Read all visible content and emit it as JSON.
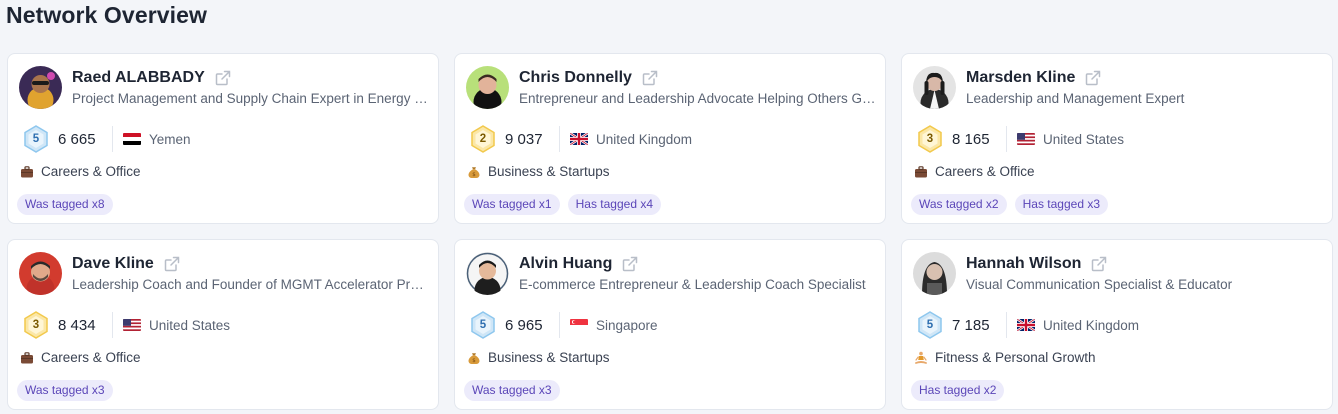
{
  "page": {
    "title": "Network Overview"
  },
  "colors": {
    "tag_bg": "#ecebfb",
    "tag_text": "#5b46b8",
    "gold_badge": "#f2c94c",
    "blue_badge": "#8ec7ee"
  },
  "profiles": [
    {
      "name": "Raed ALABBADY",
      "headline": "Project Management and Supply Chain Expert in Energy Sector",
      "level": "5",
      "level_style": "blue",
      "followers": "6 665",
      "flag": "yemen",
      "country": "Yemen",
      "category_icon": "briefcase-icon",
      "category": "Careers & Office",
      "tags": [
        "Was tagged x8"
      ]
    },
    {
      "name": "Chris Donnelly",
      "headline": "Entrepreneur and Leadership Advocate Helping Others Grow",
      "level": "2",
      "level_style": "gold",
      "followers": "9 037",
      "flag": "uk",
      "country": "United Kingdom",
      "category_icon": "money-bag-icon",
      "category": "Business & Startups",
      "tags": [
        "Was tagged x1",
        "Has tagged x4"
      ]
    },
    {
      "name": "Marsden Kline",
      "headline": "Leadership and Management Expert",
      "level": "3",
      "level_style": "gold",
      "followers": "8 165",
      "flag": "us",
      "country": "United States",
      "category_icon": "briefcase-icon",
      "category": "Careers & Office",
      "tags": [
        "Was tagged x2",
        "Has tagged x3"
      ]
    },
    {
      "name": "Dave Kline",
      "headline": "Leadership Coach and Founder of MGMT Accelerator Program",
      "level": "3",
      "level_style": "gold",
      "followers": "8 434",
      "flag": "us",
      "country": "United States",
      "category_icon": "briefcase-icon",
      "category": "Careers & Office",
      "tags": [
        "Was tagged x3"
      ]
    },
    {
      "name": "Alvin Huang",
      "headline": "E-commerce Entrepreneur & Leadership Coach Specialist",
      "level": "5",
      "level_style": "blue",
      "followers": "6 965",
      "flag": "singapore",
      "country": "Singapore",
      "category_icon": "money-bag-icon",
      "category": "Business & Startups",
      "tags": [
        "Was tagged x3"
      ]
    },
    {
      "name": "Hannah Wilson",
      "headline": "Visual Communication Specialist & Educator",
      "level": "5",
      "level_style": "blue",
      "followers": "7 185",
      "flag": "uk",
      "country": "United Kingdom",
      "category_icon": "person-meditating-icon",
      "category": "Fitness & Personal Growth",
      "tags": [
        "Has tagged x2"
      ]
    }
  ]
}
